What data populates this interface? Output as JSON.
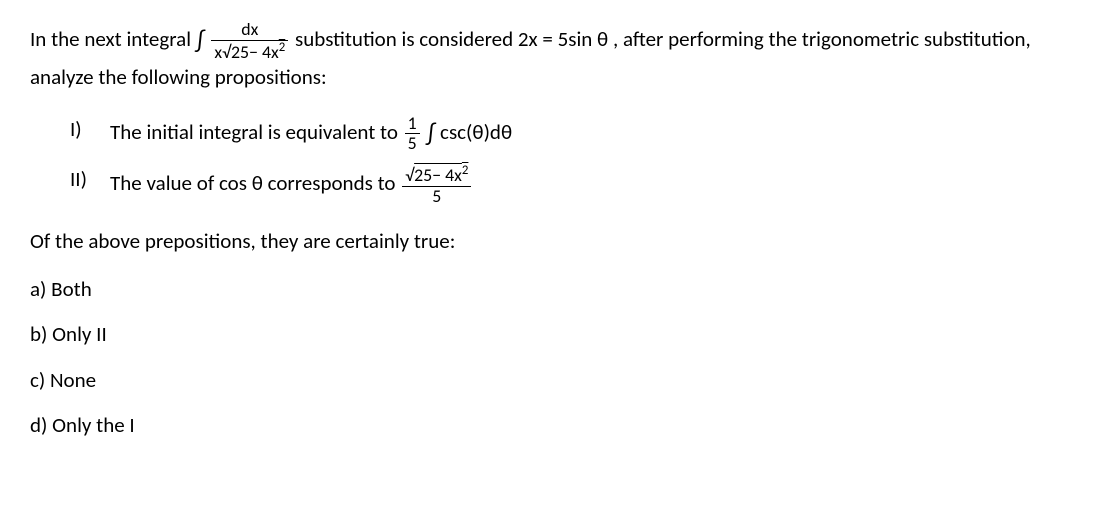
{
  "intro": {
    "part1": "In the next integral ",
    "integral_sym": "∫",
    "frac1_num": "dx",
    "frac1_den_x": "x",
    "frac1_den_sqrt_pre": "√",
    "frac1_den_sqrt_body": "25− 4x",
    "frac1_den_sqrt_sup": "2",
    "part2": " substitution is considered ",
    "eq": "2x  =  5sin θ",
    "part3": ", after performing the trigonometric substitution, analyze the following propositions:"
  },
  "propositions": [
    {
      "num": "I)",
      "text1": "The initial integral is equivalent to ",
      "frac_num": "1",
      "frac_den": "5",
      "integral_sym": "∫",
      "text2": " csc(θ)dθ"
    },
    {
      "num": "II)",
      "text1": "The value of cos θ corresponds to ",
      "frac_num_sqrt_pre": "√",
      "frac_num_sqrt_body": "25− 4x",
      "frac_num_sqrt_sup": "2",
      "frac_den": "5"
    }
  ],
  "followup": "Of the above prepositions, they are certainly true:",
  "options": [
    "a) Both",
    "b) Only II",
    "c) None",
    "d) Only the I"
  ]
}
